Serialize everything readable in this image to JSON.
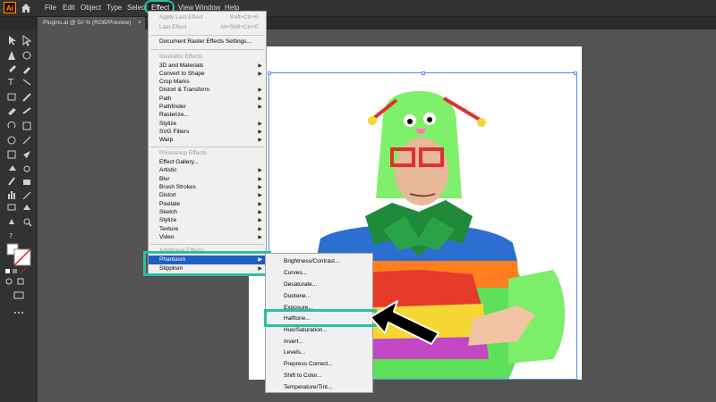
{
  "app": {
    "logo": "Ai"
  },
  "menubar": {
    "items": [
      "File",
      "Edit",
      "Object",
      "Type",
      "Select",
      "Effect",
      "View",
      "Window",
      "Help"
    ],
    "active": "Effect"
  },
  "tab": {
    "title": "Plugins.ai @ 50 % (RGB/Preview)",
    "close": "×"
  },
  "effect_menu": {
    "apply_last": {
      "label": "Apply Last Effect",
      "shortcut": "Shift+Ctrl+E"
    },
    "last": {
      "label": "Last Effect",
      "shortcut": "Alt+Shift+Ctrl+E"
    },
    "doc_raster": "Document Raster Effects Settings...",
    "illustrator_header": "Illustrator Effects",
    "illustrator_items": [
      "3D and Materials",
      "Convert to Shape",
      "Crop Marks",
      "Distort & Transform",
      "Path",
      "Pathfinder",
      "Rasterize...",
      "Stylize",
      "SVG Filters",
      "Warp"
    ],
    "photoshop_header": "Photoshop Effects",
    "photoshop_items": [
      "Effect Gallery...",
      "Artistic",
      "Blur",
      "Brush Strokes",
      "Distort",
      "Pixelate",
      "Sketch",
      "Stylize",
      "Texture",
      "Video"
    ],
    "plugin_header": "Additional Effects",
    "plugin_items": [
      "Phantasm",
      "Stipplism"
    ]
  },
  "phantasm_submenu": {
    "items": [
      "Brightness/Contrast...",
      "Curves...",
      "Desaturate...",
      "Duotone...",
      "Exposure...",
      "Halftone...",
      "Hue/Saturation...",
      "Invert...",
      "Levels...",
      "Prepress Correct...",
      "Shift to Color...",
      "Temperature/Tint..."
    ],
    "highlighted": "Halftone..."
  },
  "colors": {
    "accent_teal": "#2bbfa4",
    "selection_blue": "#4e8ff7",
    "menu_bg": "#f0f0f0",
    "ui_dark": "#323232"
  }
}
